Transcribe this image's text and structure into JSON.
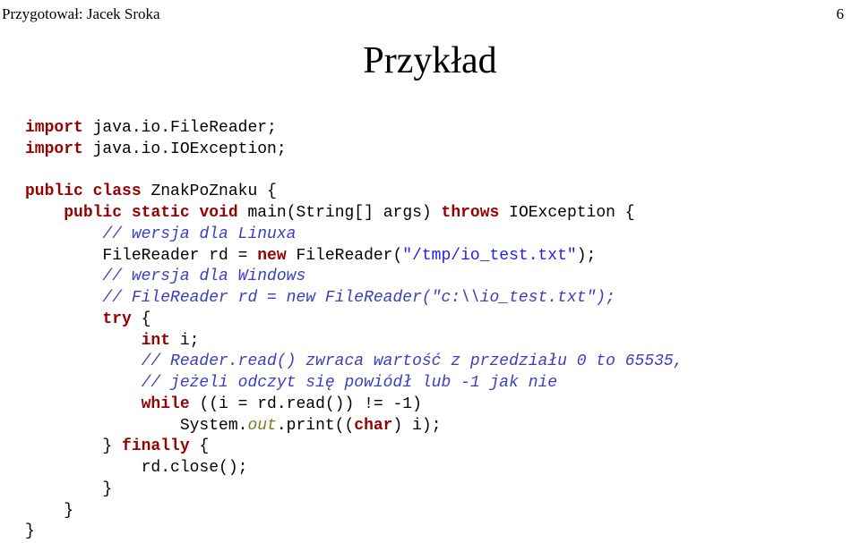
{
  "header": {
    "author_label": "Przygotował: Jacek Sroka",
    "page_number": "6"
  },
  "title": "Przykład",
  "code": {
    "import1a": "import",
    "import1b": " java.io.FileReader;",
    "import2a": "import",
    "import2b": " java.io.IOException;",
    "public1": "public",
    "class_kw": "class",
    "class_name": " ZnakPoZnaku {",
    "public2": "public",
    "static_kw": "static",
    "void_kw": "void",
    "main_sig": " main(String[] args) ",
    "throws_kw": "throws",
    "ioex": " IOException {",
    "c_linux": "// wersja dla Linuxa",
    "filereader_decl1": "        FileReader rd = ",
    "new_kw": "new",
    "filereader_ctor1a": " FileReader(",
    "str1": "\"/tmp/io_test.txt\"",
    "filereader_ctor1b": ");",
    "c_windows": "// wersja dla Windows",
    "c_fr2": "// FileReader rd = new FileReader(\"c:\\\\io_test.txt\");",
    "try_kw": "try",
    "try_brace": " {",
    "int_kw": "int",
    "int_var": " i;",
    "c_reader": "// Reader.read() zwraca wartość z przedziału 0 to 65535,",
    "c_jezeli": "// jeżeli odczyt się powiódł lub -1 jak nie",
    "while_kw": "while",
    "while_cond": " ((i = rd.read()) != -1)",
    "sys_line1": "                System.",
    "out_olive": "out",
    "sys_line2": ".print((",
    "char_kw": "char",
    "sys_line3": ") i);",
    "finally_pre": "        } ",
    "finally_kw": "finally",
    "finally_brace": " {",
    "rd_close": "            rd.close();",
    "brace1": "        }",
    "brace2": "    }",
    "brace3": "}"
  }
}
